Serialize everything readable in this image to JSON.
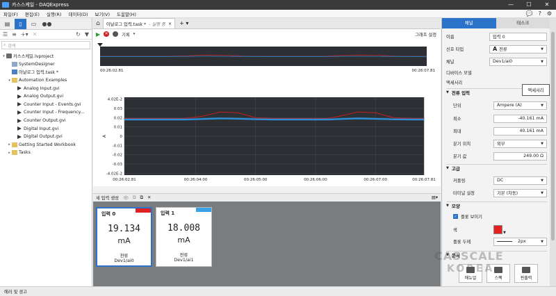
{
  "window": {
    "title": "카스스케일 - DAQExpress",
    "min": "—",
    "max": "☐",
    "close": "✕"
  },
  "menu": [
    "파일(F)",
    "편집(E)",
    "실행(R)",
    "데이터(D)",
    "보기(V)",
    "도움말(H)"
  ],
  "menu_right": {
    "chat": "💬",
    "help": "?",
    "gear": "⚙"
  },
  "left_panel": {
    "search_placeholder": "검색",
    "tree": [
      {
        "label": "카스스케일.lvproject",
        "level": 0,
        "expander": "▾",
        "icon": "proj"
      },
      {
        "label": "SystemDesigner",
        "level": 1,
        "expander": "",
        "icon": "sys"
      },
      {
        "label": "아날로그 입력.task *",
        "level": 1,
        "expander": "",
        "icon": "task"
      },
      {
        "label": "Automation Examples",
        "level": 1,
        "expander": "▾",
        "icon": "folder"
      },
      {
        "label": "Analog Input.gvi",
        "level": 2,
        "expander": "",
        "icon": "gvi"
      },
      {
        "label": "Analog Output.gvi",
        "level": 2,
        "expander": "",
        "icon": "gvi"
      },
      {
        "label": "Counter Input - Events.gvi",
        "level": 2,
        "expander": "",
        "icon": "gvi"
      },
      {
        "label": "Counter Input - Frequency...",
        "level": 2,
        "expander": "",
        "icon": "gvi"
      },
      {
        "label": "Counter Output.gvi",
        "level": 2,
        "expander": "",
        "icon": "gvi"
      },
      {
        "label": "Digital Input.gvi",
        "level": 2,
        "expander": "",
        "icon": "gvi"
      },
      {
        "label": "Digital Output.gvi",
        "level": 2,
        "expander": "",
        "icon": "gvi"
      },
      {
        "label": "Getting Started Workbook",
        "level": 1,
        "expander": "▸",
        "icon": "folder"
      },
      {
        "label": "Tasks",
        "level": 1,
        "expander": "▸",
        "icon": "folder"
      }
    ]
  },
  "doc": {
    "tab_label": "아날로그 입력.task *",
    "tab_status": "- 실행 중",
    "tab_close": "×",
    "toolbar_record": "기록",
    "toolbar_graph_settings": "그래프 설정"
  },
  "overview": {
    "start": "00:26:02.81",
    "end": "00:26:07.81"
  },
  "chart_data": {
    "type": "line",
    "title": "",
    "xlabel": "",
    "ylabel": "A",
    "ylim": [
      -0.042,
      0.042
    ],
    "yticks": [
      "4.02E-2",
      "0.03",
      "0.02",
      "0.01",
      "0",
      "-0.01",
      "-0.02",
      "-0.03",
      "-4.02E-2"
    ],
    "xticks": [
      "00:26:02.81",
      "00:26:04:00",
      "00:26:05:00",
      "00:26:06:00",
      "00:26:07:00",
      "00:26:07.81"
    ],
    "x": [
      0,
      0.5,
      1.0,
      1.3,
      1.6,
      1.9,
      2.2,
      2.5,
      2.8,
      3.1,
      3.4,
      3.6,
      3.9,
      4.2,
      4.5,
      4.8,
      5.0
    ],
    "series": [
      {
        "color": "#c81e1e",
        "values": [
          0.0191,
          0.0191,
          0.0191,
          0.0215,
          0.0262,
          0.0252,
          0.0198,
          0.0191,
          0.0191,
          0.0191,
          0.0191,
          0.0218,
          0.0262,
          0.0252,
          0.0198,
          0.0191,
          0.0191
        ]
      },
      {
        "color": "#2a8fd8",
        "values": [
          0.018,
          0.018,
          0.018,
          0.0185,
          0.0192,
          0.0188,
          0.0183,
          0.018,
          0.018,
          0.018,
          0.018,
          0.0185,
          0.0191,
          0.0187,
          0.0182,
          0.018,
          0.018
        ]
      }
    ],
    "grid": true
  },
  "strip": {
    "new_input": "새 입력 생성"
  },
  "cards": [
    {
      "name": "입력 0",
      "value": "19.134",
      "unit": "mA",
      "type": "전류",
      "device": "Dev1/ai0",
      "flag": "#e02020"
    },
    {
      "name": "입력 1",
      "value": "18.008",
      "unit": "mA",
      "type": "전류",
      "device": "Dev1/ai1",
      "flag": "#3aa0e8"
    }
  ],
  "props": {
    "tabs": [
      "채널",
      "태스크"
    ],
    "name_label": "이름",
    "name_value": "입력 0",
    "signal_label": "신호 타입",
    "signal_value": "전류",
    "signal_icon": "A",
    "channel_label": "채널",
    "channel_value": "Dev1/ai0",
    "device_model_label": "디바이스 모델",
    "accessory_label": "액세서리",
    "sec_current_input": "전류 입력",
    "unit_label": "단위",
    "unit_value": "Ampere (A)",
    "min_label": "최소",
    "min_value": "-40.161 mA",
    "max_label": "최대",
    "max_value": "40.161 mA",
    "shunt_loc_label": "분기 위치",
    "shunt_loc_value": "외부",
    "shunt_val_label": "분기 값",
    "shunt_val_value": "249.00 Ω",
    "sec_advanced": "고급",
    "coupling_label": "커플링",
    "coupling_value": "DC",
    "terminal_label": "터미널 설정",
    "terminal_value": "기본 (차동)",
    "sec_appearance": "모양",
    "show_plot_label": "플롯 보이기",
    "color_label": "색",
    "plot_width_label": "플롯 두께",
    "plot_width_value": "2px",
    "sec_docs": "문서",
    "btn_manual": "매뉴얼",
    "btn_spec": "스펙",
    "btn_pinout": "핀출력",
    "tooltip": "액세서리"
  },
  "status": {
    "errors": "에러 및 경고"
  },
  "watermark": {
    "line1": "CASSCALE",
    "line2": "KOREA"
  }
}
